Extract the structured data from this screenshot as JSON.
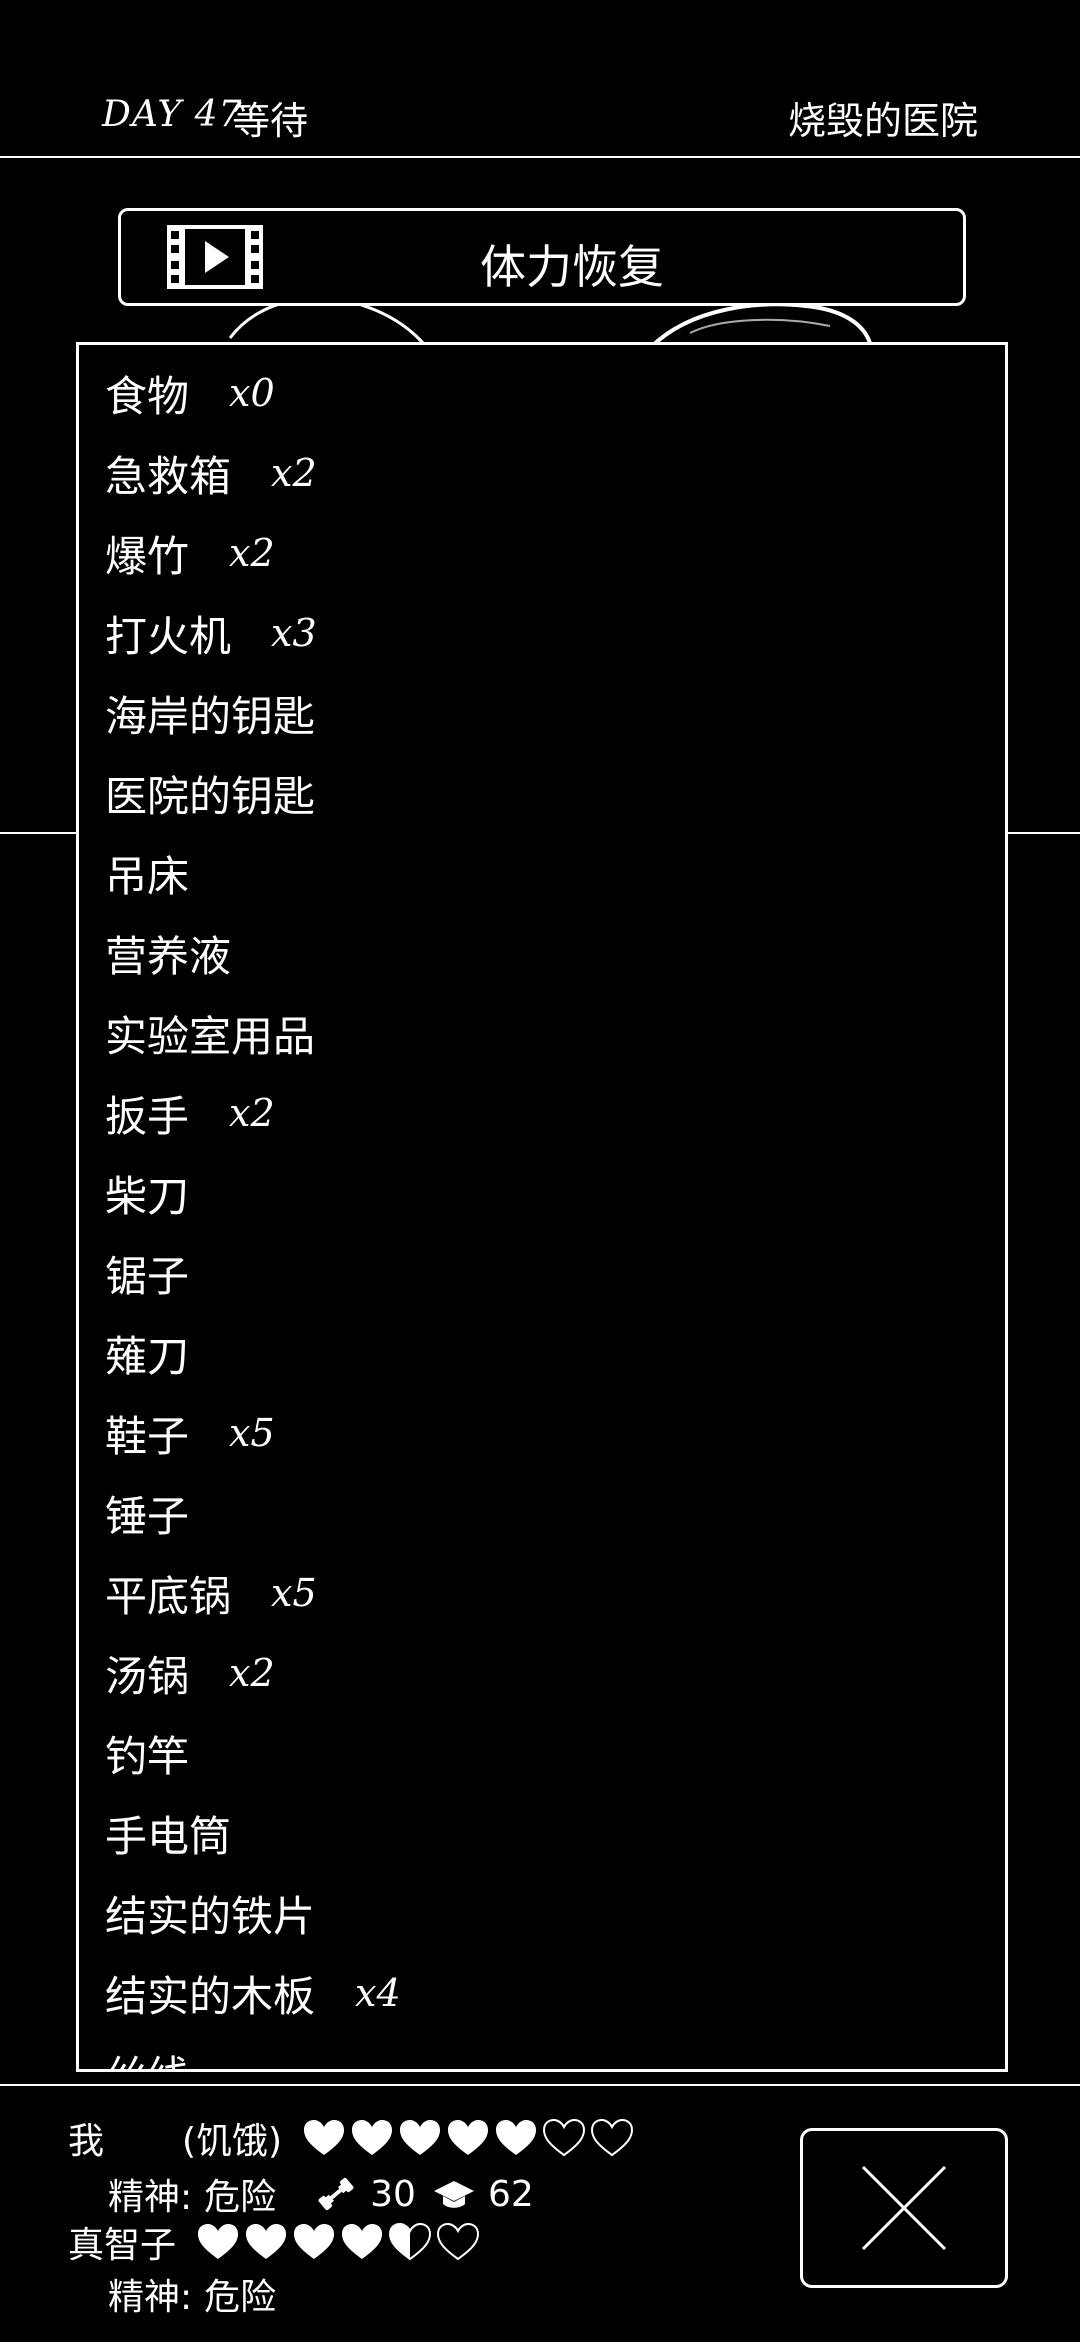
{
  "header": {
    "day": "DAY 47",
    "status": "等待",
    "location": "烧毁的医院"
  },
  "recover_button": {
    "label": "体力恢复",
    "icon": "video-icon"
  },
  "inventory": {
    "items": [
      {
        "name": "食物",
        "qty": "x0"
      },
      {
        "name": "急救箱",
        "qty": "x2"
      },
      {
        "name": "爆竹",
        "qty": "x2"
      },
      {
        "name": "打火机",
        "qty": "x3"
      },
      {
        "name": "海岸的钥匙",
        "qty": ""
      },
      {
        "name": "医院的钥匙",
        "qty": ""
      },
      {
        "name": "吊床",
        "qty": ""
      },
      {
        "name": "营养液",
        "qty": ""
      },
      {
        "name": "实验室用品",
        "qty": ""
      },
      {
        "name": "扳手",
        "qty": "x2"
      },
      {
        "name": "柴刀",
        "qty": ""
      },
      {
        "name": "锯子",
        "qty": ""
      },
      {
        "name": "薙刀",
        "qty": ""
      },
      {
        "name": "鞋子",
        "qty": "x5"
      },
      {
        "name": "锤子",
        "qty": ""
      },
      {
        "name": "平底锅",
        "qty": "x5"
      },
      {
        "name": "汤锅",
        "qty": "x2"
      },
      {
        "name": "钓竿",
        "qty": ""
      },
      {
        "name": "手电筒",
        "qty": ""
      },
      {
        "name": "结实的铁片",
        "qty": ""
      },
      {
        "name": "结实的木板",
        "qty": "x4"
      },
      {
        "name": "丝线",
        "qty": ""
      }
    ]
  },
  "characters": [
    {
      "name": "我",
      "condition": "(饥饿)",
      "hearts": {
        "full": 5,
        "half": 0,
        "empty": 2
      },
      "spirit_label": "精神:",
      "spirit_value": "危险",
      "strength_icon": "dumbbell-icon",
      "strength": "30",
      "intel_icon": "graduation-cap-icon",
      "intel": "62"
    },
    {
      "name": "真智子",
      "hearts": {
        "full": 4,
        "half": 1,
        "empty": 1
      },
      "spirit_label": "精神:",
      "spirit_value": "危险"
    }
  ],
  "close_button": {
    "icon": "close-icon"
  },
  "colors": {
    "background": "#000000",
    "foreground": "#ffffff"
  }
}
